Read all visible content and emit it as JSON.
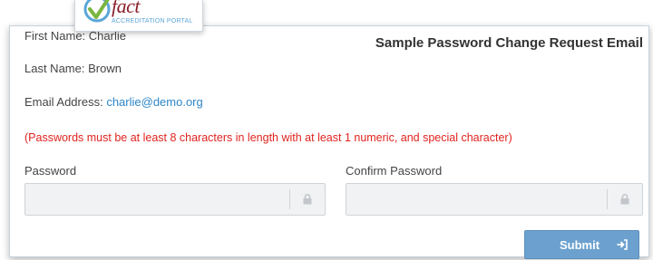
{
  "logo": {
    "word": "fact",
    "subtitle": "ACCREDITATION PORTAL"
  },
  "overlay_title": "Sample Password Change Request Email",
  "user": {
    "first_name_label": "First Name: Charlie",
    "last_name_label": "Last Name: Brown",
    "email_label": "Email Address: ",
    "email_value": "charlie@demo.org"
  },
  "warning": "(Passwords must be at least 8 characters in length with at least 1 numeric, and special character)",
  "form": {
    "password_label": "Password",
    "confirm_label": "Confirm Password",
    "password_value": "",
    "confirm_value": ""
  },
  "submit_label": "Submit",
  "colors": {
    "accent": "#6ca1cf",
    "warning": "#e0241f",
    "link": "#2e86c8",
    "brand": "#8a1f2b"
  },
  "icons": {
    "field_icon": "lock-icon",
    "submit_icon": "sign-in-icon",
    "logo_icon": "check-circle-icon"
  }
}
